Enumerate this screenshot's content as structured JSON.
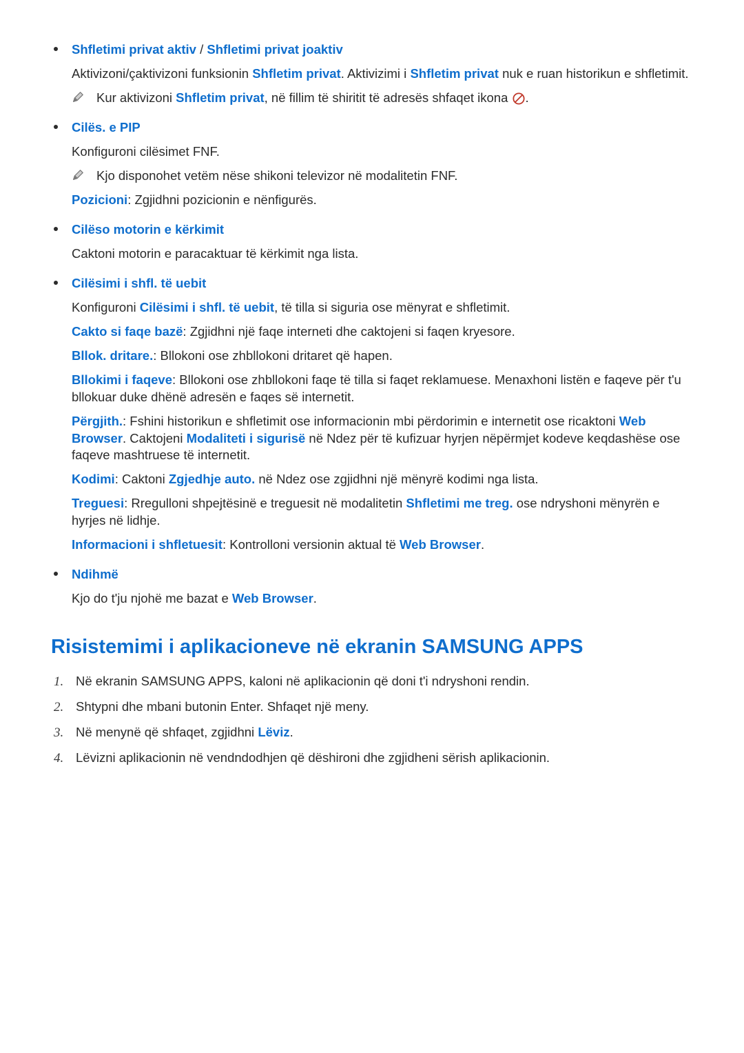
{
  "bullets": [
    {
      "title_parts": [
        {
          "text": "Shfletimi privat aktiv",
          "blue": true
        },
        {
          "text": " / ",
          "blue": false
        },
        {
          "text": "Shfletimi privat joaktiv",
          "blue": true
        }
      ],
      "paras": [
        [
          {
            "text": "Aktivizoni/çaktivizoni funksionin "
          },
          {
            "text": "Shfletim privat",
            "blue": true
          },
          {
            "text": ". Aktivizimi i "
          },
          {
            "text": "Shfletim privat",
            "blue": true
          },
          {
            "text": " nuk e ruan historikun e shfletimit."
          }
        ]
      ],
      "notes": [
        [
          {
            "text": "Kur aktivizoni "
          },
          {
            "text": "Shfletim privat",
            "blue": true,
            "bold": true
          },
          {
            "text": ", në fillim të shiritit të adresës shfaqet ikona "
          },
          {
            "icon": "no-entry"
          },
          {
            "text": "."
          }
        ]
      ]
    },
    {
      "title_parts": [
        {
          "text": "Cilës. e PIP",
          "blue": true
        }
      ],
      "paras": [
        [
          {
            "text": "Konfiguroni cilësimet FNF."
          }
        ]
      ],
      "notes": [
        [
          {
            "text": "Kjo disponohet vetëm nëse shikoni televizor në modalitetin FNF."
          }
        ]
      ],
      "after_paras": [
        [
          {
            "text": "Pozicioni",
            "blue": true
          },
          {
            "text": ": Zgjidhni pozicionin e nënfigurës."
          }
        ]
      ]
    },
    {
      "title_parts": [
        {
          "text": "Cilëso motorin e kërkimit",
          "blue": true
        }
      ],
      "paras": [
        [
          {
            "text": "Caktoni motorin e paracaktuar të kërkimit nga lista."
          }
        ]
      ]
    },
    {
      "title_parts": [
        {
          "text": "Cilësimi i shfl. të uebit",
          "blue": true
        }
      ],
      "paras": [
        [
          {
            "text": "Konfiguroni "
          },
          {
            "text": "Cilësimi i shfl. të uebit",
            "blue": true
          },
          {
            "text": ", të tilla si siguria ose mënyrat e shfletimit."
          }
        ],
        [
          {
            "text": "Cakto si faqe bazë",
            "blue": true
          },
          {
            "text": ": Zgjidhni një faqe interneti dhe caktojeni si faqen kryesore."
          }
        ],
        [
          {
            "text": "Bllok. dritare.",
            "blue": true
          },
          {
            "text": ": Bllokoni ose zhbllokoni dritaret që hapen."
          }
        ],
        [
          {
            "text": "Bllokimi i faqeve",
            "blue": true
          },
          {
            "text": ": Bllokoni ose zhbllokoni faqe të tilla si faqet reklamuese. Menaxhoni listën e faqeve për t'u bllokuar duke dhënë adresën e faqes së internetit."
          }
        ],
        [
          {
            "text": "Përgjith.",
            "blue": true
          },
          {
            "text": ": Fshini historikun e shfletimit ose informacionin mbi përdorimin e internetit ose ricaktoni "
          },
          {
            "text": "Web Browser",
            "blue": true
          },
          {
            "text": ". Caktojeni "
          },
          {
            "text": "Modaliteti i sigurisë",
            "blue": true
          },
          {
            "text": " në Ndez  për të kufizuar hyrjen nëpërmjet kodeve keqdashëse ose faqeve mashtruese të internetit."
          }
        ],
        [
          {
            "text": "Kodimi",
            "blue": true
          },
          {
            "text": ": Caktoni "
          },
          {
            "text": "Zgjedhje auto.",
            "blue": true
          },
          {
            "text": " në Ndez  ose zgjidhni një mënyrë kodimi nga lista."
          }
        ],
        [
          {
            "text": "Treguesi",
            "blue": true
          },
          {
            "text": ": Rregulloni shpejtësinë e treguesit në modalitetin "
          },
          {
            "text": "Shfletimi me treg.",
            "blue": true
          },
          {
            "text": " ose ndryshoni mënyrën e hyrjes në lidhje."
          }
        ],
        [
          {
            "text": "Informacioni i shfletuesit",
            "blue": true
          },
          {
            "text": ": Kontrolloni versionin aktual të "
          },
          {
            "text": "Web Browser",
            "blue": true
          },
          {
            "text": "."
          }
        ]
      ]
    },
    {
      "title_parts": [
        {
          "text": "Ndihmë",
          "blue": true
        }
      ],
      "paras": [
        [
          {
            "text": "Kjo do t'ju njohë me bazat e "
          },
          {
            "text": "Web Browser",
            "blue": true
          },
          {
            "text": "."
          }
        ]
      ]
    }
  ],
  "section_heading": "Risistemimi i aplikacioneve në ekranin SAMSUNG APPS",
  "steps": [
    [
      {
        "text": "Në ekranin SAMSUNG APPS, kaloni në aplikacionin që doni t'i ndryshoni rendin."
      }
    ],
    [
      {
        "text": "Shtypni dhe mbani butonin Enter. Shfaqet një meny."
      }
    ],
    [
      {
        "text": "Në menynë që shfaqet, zgjidhni "
      },
      {
        "text": "Lëviz",
        "blue": true
      },
      {
        "text": "."
      }
    ],
    [
      {
        "text": "Lëvizni aplikacionin në vendndodhjen që dëshironi dhe zgjidheni sërish aplikacionin."
      }
    ]
  ]
}
